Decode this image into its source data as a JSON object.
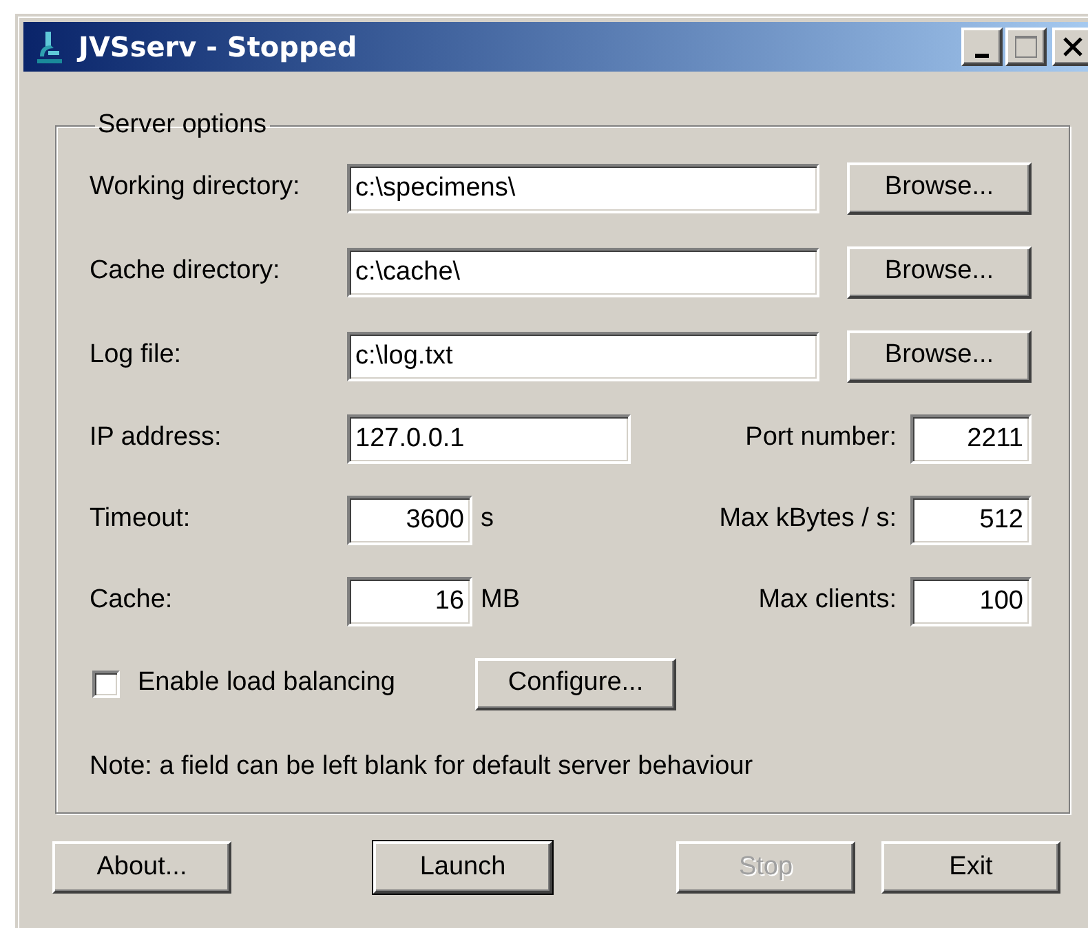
{
  "window": {
    "title": "JVSserv - Stopped"
  },
  "group": {
    "title": "Server options"
  },
  "rows": [
    {
      "kind": "path",
      "label": "Working directory:",
      "value": "c:\\specimens\\",
      "button": "Browse..."
    },
    {
      "kind": "path",
      "label": "Cache directory:",
      "value": "c:\\cache\\",
      "button": "Browse..."
    },
    {
      "kind": "path",
      "label": "Log file:",
      "value": "c:\\log.txt",
      "button": "Browse..."
    },
    {
      "kind": "address",
      "label": "IP address:",
      "value": "127.0.0.1",
      "right_label": "Port number:",
      "right_value": "2211"
    },
    {
      "kind": "number",
      "label": "Timeout:",
      "value": "3600",
      "unit": "s",
      "right_label": "Max kBytes / s:",
      "right_value": "512"
    },
    {
      "kind": "number",
      "label": "Cache:",
      "value": "16",
      "unit": "MB",
      "right_label": "Max clients:",
      "right_value": "100"
    }
  ],
  "load_balancing": {
    "label": "Enable load balancing",
    "checked": false,
    "button": "Configure..."
  },
  "note": "Note: a field can be left blank for default server behaviour",
  "buttons": [
    {
      "label": "About...",
      "default": false,
      "disabled": false
    },
    {
      "label": "Launch",
      "default": true,
      "disabled": false
    },
    {
      "label": "Stop",
      "default": false,
      "disabled": true
    },
    {
      "label": "Exit",
      "default": false,
      "disabled": false
    }
  ]
}
